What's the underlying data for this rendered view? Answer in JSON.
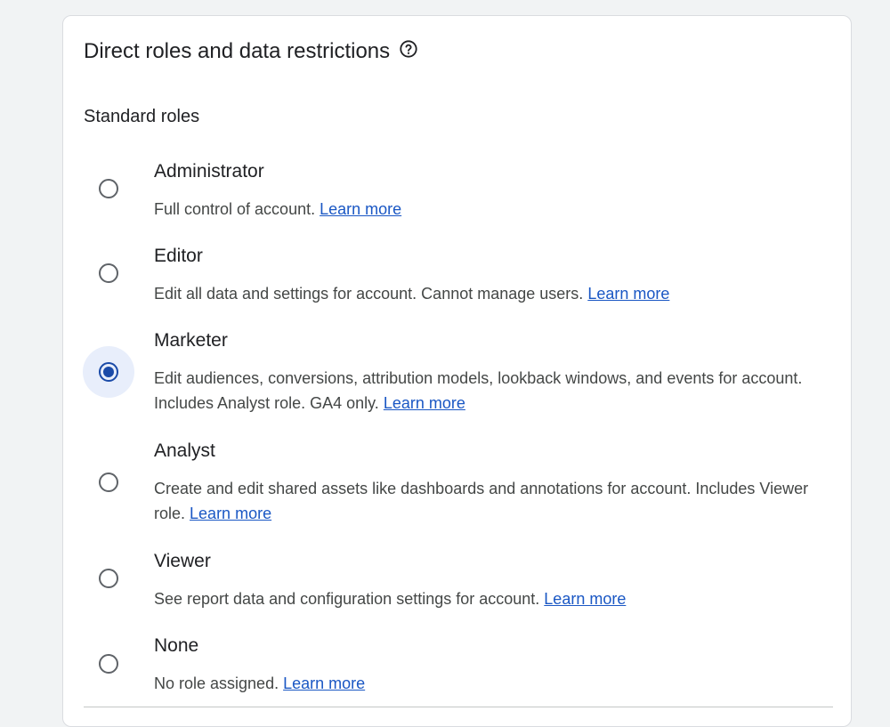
{
  "card": {
    "title": "Direct roles and data restrictions",
    "help_icon": "help-circle-icon"
  },
  "section": {
    "title": "Standard roles"
  },
  "roles": [
    {
      "name": "Administrator",
      "description": "Full control of account.",
      "link": "Learn more",
      "selected": false
    },
    {
      "name": "Editor",
      "description": "Edit all data and settings for account. Cannot manage users.",
      "link": "Learn more",
      "selected": false
    },
    {
      "name": "Marketer",
      "description": "Edit audiences, conversions, attribution models, lookback windows, and events for account. Includes Analyst role. GA4 only.",
      "link": "Learn more",
      "selected": true
    },
    {
      "name": "Analyst",
      "description": "Create and edit shared assets like dashboards and annotations for account. Includes Viewer role.",
      "link": "Learn more",
      "selected": false
    },
    {
      "name": "Viewer",
      "description": "See report data and configuration settings for account.",
      "link": "Learn more",
      "selected": false
    },
    {
      "name": "None",
      "description": "No role assigned.",
      "link": "Learn more",
      "selected": false
    }
  ],
  "colors": {
    "accent": "#1a4aa8",
    "link": "#1a57c4",
    "selected_halo": "#e8eefb"
  }
}
